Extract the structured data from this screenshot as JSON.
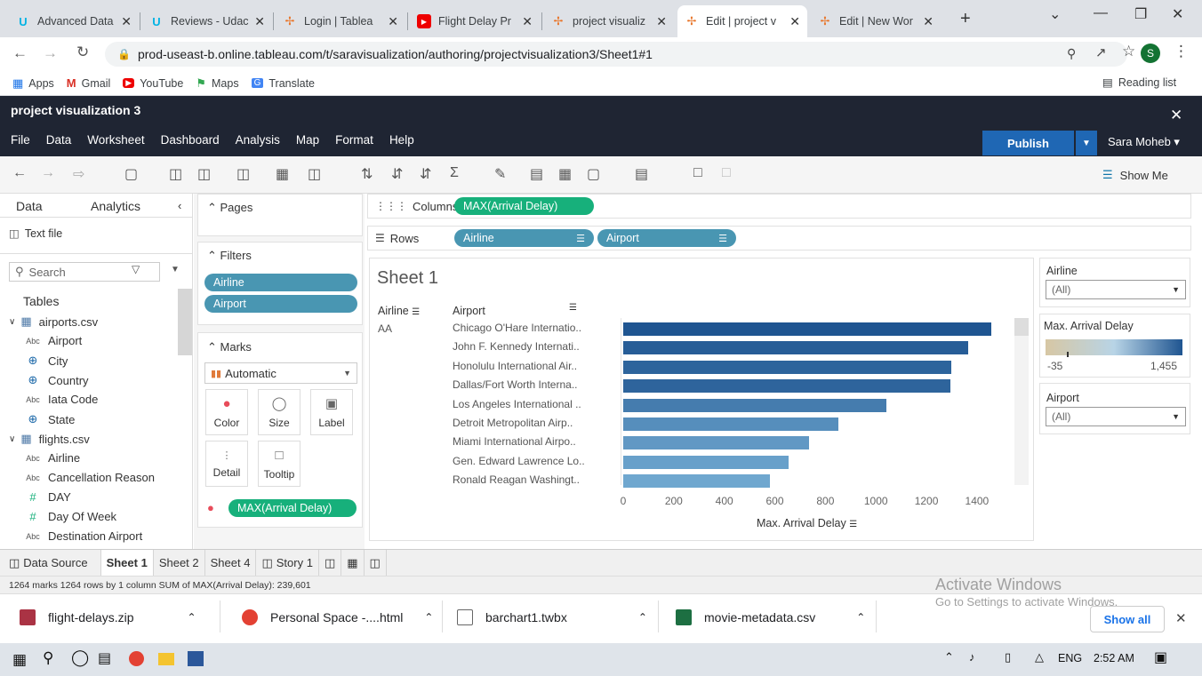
{
  "browser": {
    "tabs": [
      {
        "title": "Advanced Data",
        "icon": "udacity-icon"
      },
      {
        "title": "Reviews - Udac",
        "icon": "udacity-icon"
      },
      {
        "title": "Login | Tablea",
        "icon": "tableau-icon"
      },
      {
        "title": "Flight Delay Pr",
        "icon": "youtube-icon"
      },
      {
        "title": "project visualiz",
        "icon": "tableau-icon"
      },
      {
        "title": "Edit | project v",
        "icon": "tableau-icon"
      },
      {
        "title": "Edit | New Wor",
        "icon": "tableau-icon"
      }
    ],
    "url": "prod-useast-b.online.tableau.com/t/saravisualization/authoring/projectvisualization3/Sheet1#1",
    "profile_initial": "S",
    "bookmarks": [
      "Apps",
      "Gmail",
      "YouTube",
      "Maps",
      "Translate"
    ],
    "reading_list": "Reading list"
  },
  "tableau": {
    "workbook_title": "project visualization 3",
    "menu": [
      "File",
      "Data",
      "Worksheet",
      "Dashboard",
      "Analysis",
      "Map",
      "Format",
      "Help"
    ],
    "publish_label": "Publish",
    "user": "Sara Moheb ▾",
    "show_me": "Show Me",
    "data_tab": "Data",
    "analytics_tab": "Analytics",
    "data_source": "Text file",
    "search_placeholder": "Search",
    "tables_label": "Tables",
    "tables": [
      {
        "name": "airports.csv",
        "fields": [
          {
            "type": "Abc",
            "name": "Airport"
          },
          {
            "type": "⊕",
            "name": "City"
          },
          {
            "type": "⊕",
            "name": "Country"
          },
          {
            "type": "Abc",
            "name": "Iata Code"
          },
          {
            "type": "⊕",
            "name": "State"
          }
        ]
      },
      {
        "name": "flights.csv",
        "fields": [
          {
            "type": "Abc",
            "name": "Airline"
          },
          {
            "type": "Abc",
            "name": "Cancellation Reason"
          },
          {
            "type": "#",
            "name": "DAY"
          },
          {
            "type": "#",
            "name": "Day Of Week"
          },
          {
            "type": "Abc",
            "name": "Destination Airport"
          }
        ]
      }
    ],
    "pages_label": "Pages",
    "filters_label": "Filters",
    "filters": [
      "Airline",
      "Airport"
    ],
    "marks_label": "Marks",
    "mark_type": "Automatic",
    "mark_buttons": [
      "Color",
      "Size",
      "Label",
      "Detail",
      "Tooltip"
    ],
    "color_pill": "MAX(Arrival Delay)",
    "columns_label": "Columns",
    "rows_label": "Rows",
    "columns_pill": "MAX(Arrival Delay)",
    "rows_pills": [
      "Airline",
      "Airport"
    ],
    "sheet_title": "Sheet 1",
    "header_airline": "Airline",
    "header_airport": "Airport",
    "airline_value": "AA",
    "legend_airline_title": "Airline",
    "legend_airline_value": "(All)",
    "legend_color_title": "Max. Arrival Delay",
    "legend_color_min": "-35",
    "legend_color_max": "1,455",
    "legend_airport_title": "Airport",
    "legend_airport_value": "(All)",
    "sheet_tabs": [
      "Data Source",
      "Sheet 1",
      "Sheet 2",
      "Sheet 4",
      "Story 1"
    ],
    "status": "1264 marks   1264 rows by 1 column   SUM of MAX(Arrival Delay): 239,601"
  },
  "chart_data": {
    "type": "bar",
    "orientation": "horizontal",
    "categories": [
      "Chicago O'Hare Internatio..",
      "John F. Kennedy Internati..",
      "Honolulu International Air..",
      "Dallas/Fort Worth Interna..",
      "Los Angeles International ..",
      "Detroit Metropolitan Airp..",
      "Miami International Airpo..",
      "Gen. Edward Lawrence Lo..",
      "Ronald Reagan Washingt.."
    ],
    "values": [
      1455,
      1365,
      1300,
      1295,
      1040,
      850,
      735,
      655,
      580
    ],
    "xlabel": "Max. Arrival Delay",
    "xticks": [
      0,
      200,
      400,
      600,
      800,
      1000,
      1200,
      1400
    ],
    "xlim": [
      0,
      1520
    ],
    "color_range": [
      "#b8d4e6",
      "#1f5591"
    ]
  },
  "downloads": [
    {
      "name": "flight-delays.zip"
    },
    {
      "name": "Personal Space -....html"
    },
    {
      "name": "barchart1.twbx"
    },
    {
      "name": "movie-metadata.csv"
    }
  ],
  "show_all": "Show all",
  "watermark": {
    "line1": "Activate Windows",
    "line2": "Go to Settings to activate Windows."
  },
  "taskbar": {
    "lang": "ENG",
    "time": "2:52 AM"
  }
}
